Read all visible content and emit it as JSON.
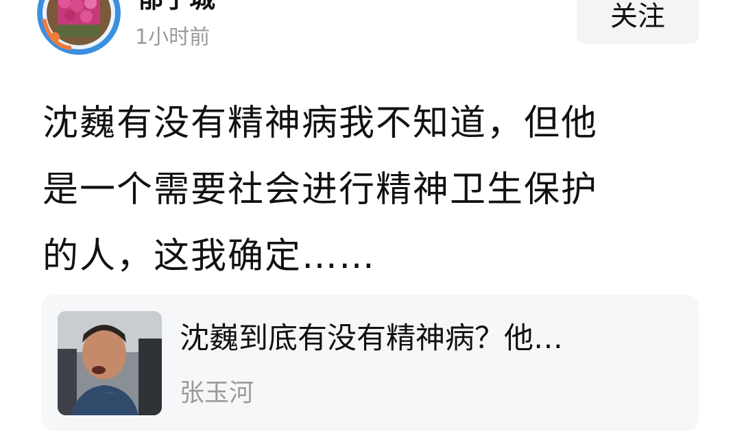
{
  "post": {
    "author_name": "郁子城",
    "time": "1小时前",
    "follow_label": "关注",
    "lines": [
      "沈巍有没有精神病我不知道，但他",
      "是一个需要社会进行精神卫生保护",
      "的人，这我确定……"
    ]
  },
  "link_card": {
    "title": "沈巍到底有没有精神病？他…",
    "source": "张玉河",
    "thumbnail_icon": "video-thumbnail-image"
  },
  "colors": {
    "primary_text": "#111111",
    "secondary_text": "#9a9a9a",
    "button_background": "#f3f4f6",
    "card_background": "#f6f7f9",
    "avatar_ring": "#3b8fe0"
  }
}
